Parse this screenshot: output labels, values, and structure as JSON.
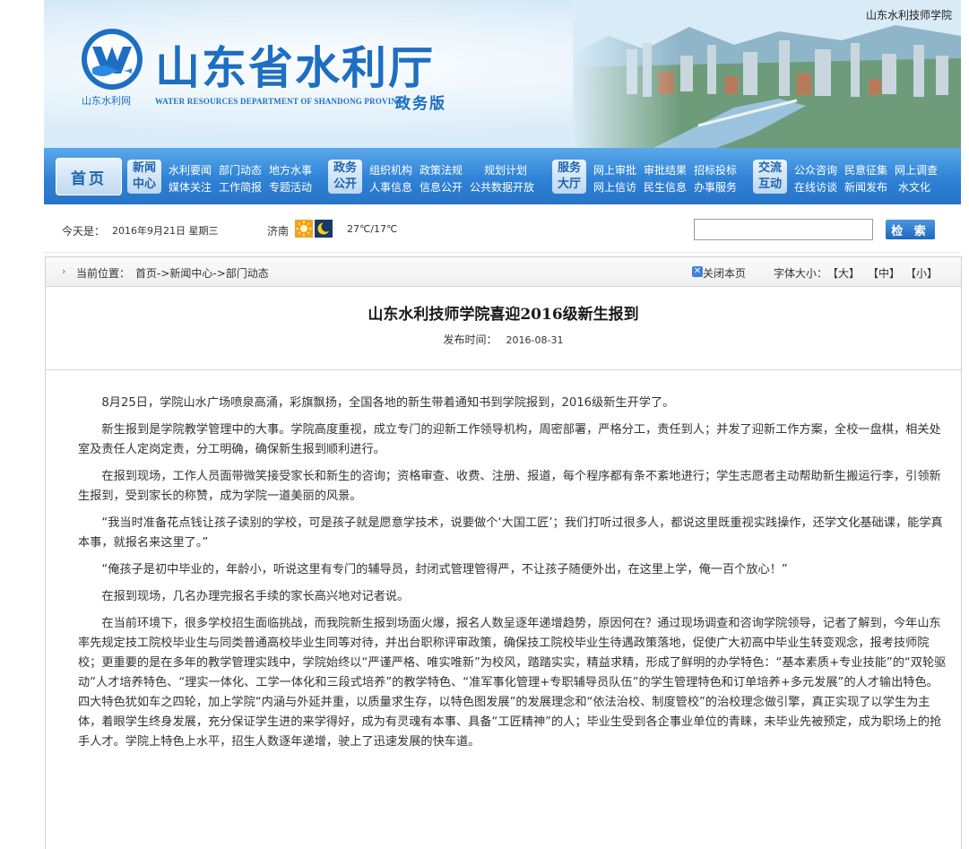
{
  "header": {
    "school_link": "山东水利技师学院",
    "logo_title": "山东省水利厅",
    "logo_cn_small": "山东水利网",
    "logo_en": "WATER RESOURCES DEPARTMENT OF SHANDONG PROVINCE",
    "logo_edition": "政务版"
  },
  "nav": {
    "home": "首页",
    "groups": [
      {
        "cat": [
          "新闻",
          "中心"
        ],
        "links": [
          [
            "水利要闻",
            "部门动态",
            "地方水事"
          ],
          [
            "媒体关注",
            "工作简报",
            "专题活动"
          ]
        ]
      },
      {
        "cat": [
          "政务",
          "公开"
        ],
        "links": [
          [
            "组织机构",
            "政策法规",
            "规划计划"
          ],
          [
            "人事信息",
            "信息公开",
            "公共数据开放"
          ]
        ]
      },
      {
        "cat": [
          "服务",
          "大厅"
        ],
        "links": [
          [
            "网上审批",
            "审批结果",
            "招标投标"
          ],
          [
            "网上信访",
            "民生信息",
            "办事服务"
          ]
        ]
      },
      {
        "cat": [
          "交流",
          "互动"
        ],
        "links": [
          [
            "公众咨询",
            "民意征集",
            "网上调查"
          ],
          [
            "在线访谈",
            "新闻发布",
            "水文化"
          ]
        ]
      }
    ]
  },
  "infobar": {
    "date_label": "今天是：",
    "date_value": "2016年9月21日  星期三",
    "city": "济南",
    "temperature": "27℃/17℃",
    "search_placeholder": "",
    "search_button": "检 索"
  },
  "breadcrumb": {
    "label": "当前位置：",
    "path": "首页->新闻中心->部门动态",
    "close": "关闭本页",
    "font_size_label": "字体大小：",
    "font_sizes": [
      "【大】",
      "【中】",
      "【小】"
    ]
  },
  "article": {
    "title": "山东水利技师学院喜迎2016级新生报到",
    "pub_label": "发布时间：",
    "pub_date": "2016-08-31",
    "paragraphs": [
      "8月25日，学院山水广场喷泉高涌，彩旗飘扬，全国各地的新生带着通知书到学院报到，2016级新生开学了。",
      "新生报到是学院教学管理中的大事。学院高度重视，成立专门的迎新工作领导机构，周密部署，严格分工，责任到人；并发了迎新工作方案，全校一盘棋，相关处室及责任人定岗定责，分工明确，确保新生报到顺利进行。",
      "在报到现场，工作人员面带微笑接受家长和新生的咨询；资格审查、收费、注册、报道，每个程序都有条不紊地进行；学生志愿者主动帮助新生搬运行李，引领新生报到，受到家长的称赞，成为学院一道美丽的风景。",
      "“我当时准备花点钱让孩子读别的学校，可是孩子就是愿意学技术，说要做个‘大国工匠’；我们打听过很多人，都说这里既重视实践操作，还学文化基础课，能学真本事，就报名来这里了。”",
      "“俺孩子是初中毕业的，年龄小，听说这里有专门的辅导员，封闭式管理管得严，不让孩子随便外出，在这里上学，俺一百个放心！”",
      "在报到现场，几名办理完报名手续的家长高兴地对记者说。",
      "在当前环境下，很多学校招生面临挑战，而我院新生报到场面火爆，报名人数呈逐年递增趋势，原因何在？通过现场调查和咨询学院领导，记者了解到，今年山东率先规定技工院校毕业生与同类普通高校毕业生同等对待，并出台职称评审政策，确保技工院校毕业生待遇政策落地，促使广大初高中毕业生转变观念，报考技师院校；更重要的是在多年的教学管理实践中，学院始终以“严谨严格、唯实唯新”为校风，踏踏实实，精益求精，形成了鲜明的办学特色：“基本素质+专业技能”的“双轮驱动”人才培养特色、“理实一体化、工学一体化和三段式培养”的教学特色、“准军事化管理+专职辅导员队伍”的学生管理特色和订单培养+多元发展”的人才输出特色。四大特色犹如车之四轮，加上学院“内涵与外延并重，以质量求生存，以特色图发展”的发展理念和“依法治校、制度管校”的治校理念做引擎，真正实现了以学生为主体，着眼学生终身发展，充分保证学生进的来学得好，成为有灵魂有本事、具备“工匠精神”的人；毕业生受到各企事业单位的青睐，未毕业先被预定，成为职场上的抢手人才。学院上特色上水平，招生人数逐年递增，驶上了迅速发展的快车道。"
    ]
  }
}
